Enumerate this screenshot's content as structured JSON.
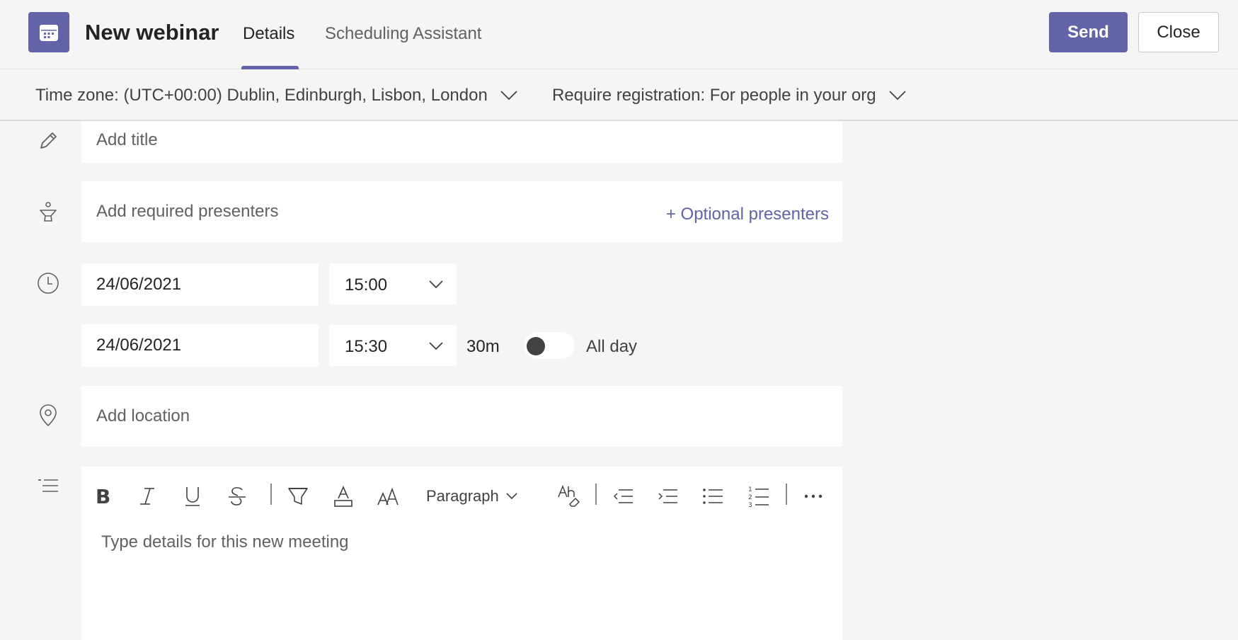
{
  "header": {
    "title": "New webinar",
    "tabs": [
      {
        "label": "Details",
        "active": true
      },
      {
        "label": "Scheduling Assistant",
        "active": false
      }
    ],
    "send_label": "Send",
    "close_label": "Close"
  },
  "subbar": {
    "timezone": "Time zone: (UTC+00:00) Dublin, Edinburgh, Lisbon, London",
    "registration": "Require registration: For people in your org"
  },
  "form": {
    "title_placeholder": "Add title",
    "presenters_placeholder": "Add required presenters",
    "optional_presenters": "+ Optional presenters",
    "start_date": "24/06/2021",
    "start_time": "15:00",
    "end_date": "24/06/2021",
    "end_time": "15:30",
    "duration": "30m",
    "all_day_label": "All day",
    "all_day_on": false,
    "location_placeholder": "Add location"
  },
  "editor": {
    "paragraph_label": "Paragraph",
    "placeholder": "Type details for this new meeting"
  },
  "colors": {
    "accent": "#6264a7",
    "background": "#f5f5f5"
  }
}
